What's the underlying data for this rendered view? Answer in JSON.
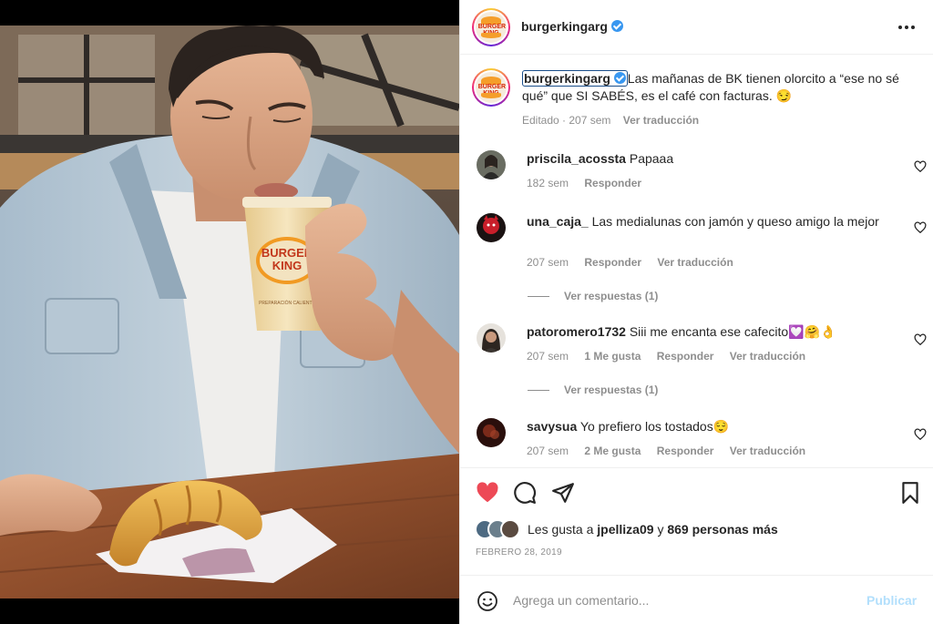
{
  "post": {
    "username": "burgerkingarg",
    "verified": true,
    "image_alt": "Man drinking coffee from a Burger King cup with a croissant on the table",
    "cup_brand": "BURGER KING",
    "cup_subtext": "PREPARACIÓN CALIENTE"
  },
  "caption": {
    "username": "burgerkingarg",
    "text": "Las mañanas de BK tienen olorcito a “ese no sé qué” que SI SABÉS, es el café con facturas. 😏",
    "edited": "Editado",
    "time": "207 sem",
    "translate": "Ver traducción"
  },
  "comments": [
    {
      "username": "priscila_acossta",
      "text": "Papaaa",
      "time": "182 sem",
      "likes": "",
      "reply": "Responder",
      "translate": ""
    },
    {
      "username": "una_caja_",
      "text": "Las medialunas con jamón y queso amigo la mejor",
      "time": "207 sem",
      "likes": "",
      "reply": "Responder",
      "translate": "Ver traducción",
      "replies": "Ver respuestas (1)"
    },
    {
      "username": "patoromero1732",
      "text": "Siii me encanta ese cafecito💟🤗👌",
      "time": "207 sem",
      "likes": "1 Me gusta",
      "reply": "Responder",
      "translate": "Ver traducción",
      "replies": "Ver respuestas (1)"
    },
    {
      "username": "savysua",
      "text": "Yo prefiero los tostados😌",
      "time": "207 sem",
      "likes": "2 Me gusta",
      "reply": "Responder",
      "translate": "Ver traducción"
    }
  ],
  "likes": {
    "prefix": "Les gusta a",
    "user": "jpelliza09",
    "conj": "y",
    "others": "869 personas más"
  },
  "date": "FEBRERO 28, 2019",
  "add_comment": {
    "placeholder": "Agrega un comentario...",
    "publish": "Publicar"
  },
  "colors": {
    "heart": "#ed4956",
    "verified": "#3897f0",
    "muted": "#8e8e8e",
    "publish_disabled": "#b2dffc"
  },
  "icons": {
    "like": "heart-filled-icon",
    "comment": "comment-bubble-icon",
    "share": "paper-plane-icon",
    "save": "bookmark-icon",
    "more": "more-horizontal-icon",
    "emoji": "emoji-smile-icon"
  }
}
